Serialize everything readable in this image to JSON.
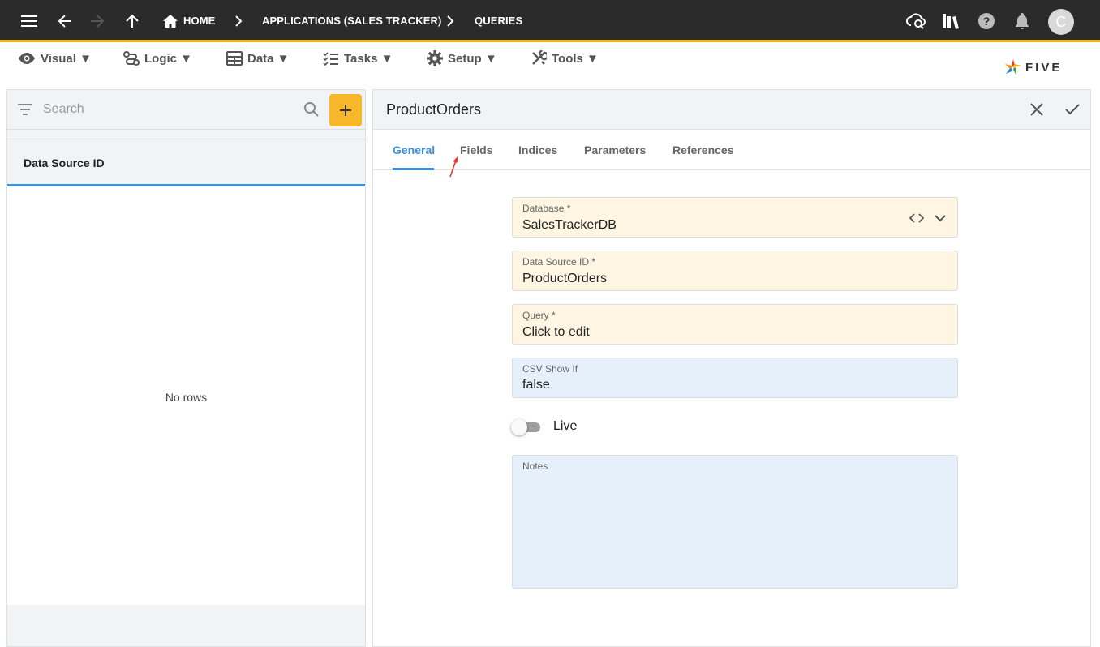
{
  "topbar": {
    "breadcrumbs": [
      "HOME",
      "APPLICATIONS (SALES TRACKER)",
      "QUERIES"
    ],
    "avatar_initial": "C",
    "icons": [
      "menu-icon",
      "back-icon",
      "forward-icon",
      "up-icon",
      "home-icon",
      "cloud-sync-icon",
      "library-icon",
      "help-icon",
      "bell-icon"
    ]
  },
  "menu": {
    "items": [
      {
        "label": "Visual ▼",
        "icon": "eye-icon"
      },
      {
        "label": "Logic ▼",
        "icon": "logic-icon"
      },
      {
        "label": "Data ▼",
        "icon": "table-icon"
      },
      {
        "label": "Tasks ▼",
        "icon": "checklist-icon"
      },
      {
        "label": "Setup ▼",
        "icon": "gear-icon"
      },
      {
        "label": "Tools ▼",
        "icon": "tools-icon"
      }
    ],
    "logo_text": "FIVE"
  },
  "left_panel": {
    "search_placeholder": "Search",
    "column_header": "Data Source ID",
    "empty_text": "No rows"
  },
  "form": {
    "title": "ProductOrders",
    "tabs": [
      "General",
      "Fields",
      "Indices",
      "Parameters",
      "References"
    ],
    "active_tab": "General",
    "fields": {
      "database": {
        "label": "Database *",
        "value": "SalesTrackerDB"
      },
      "data_source_id": {
        "label": "Data Source ID *",
        "value": "ProductOrders"
      },
      "query": {
        "label": "Query *",
        "value": "Click to edit"
      },
      "csv_show_if": {
        "label": "CSV Show If",
        "value": "false"
      },
      "live": {
        "label": "Live",
        "on": false
      },
      "notes": {
        "label": "Notes",
        "value": ""
      }
    }
  },
  "colors": {
    "topbar_bg": "#2b2b2b",
    "accent_yellow": "#f7b728",
    "accent_blue": "#3d8fe0",
    "required_field_bg": "#fef5e2",
    "optional_field_bg": "#e6f0fb"
  }
}
